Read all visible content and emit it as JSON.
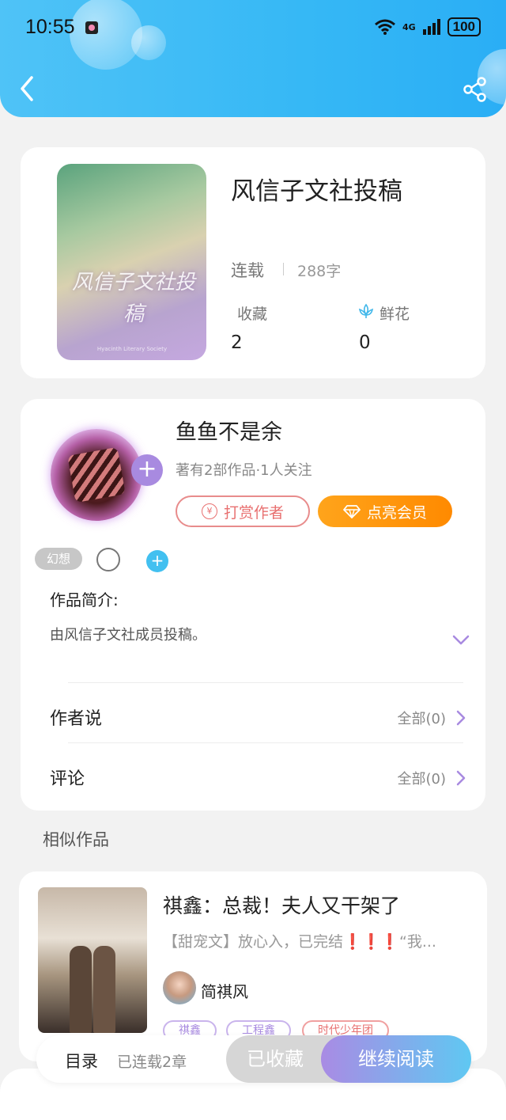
{
  "status_bar": {
    "time": "10:55",
    "network": "4G",
    "battery": "100"
  },
  "book": {
    "title": "风信子文社投稿",
    "status": "连载",
    "word_count": "288字",
    "favorites_label": "收藏",
    "favorites_count": "2",
    "flowers_label": "鲜花",
    "flowers_count": "0",
    "cover_text": "风信子文社投稿",
    "cover_subtext": "Hyacinth Literary Society"
  },
  "author": {
    "name": "鱼鱼不是余",
    "stats": "著有2部作品·1人关注",
    "tip_button": "打赏作者",
    "tip_icon_glyph": "¥",
    "vip_button": "点亮会员",
    "follow_glyph": "+",
    "tag": "幻想",
    "add_tag_glyph": "+"
  },
  "intro": {
    "label": "作品简介:",
    "text": "由风信子文社成员投稿。"
  },
  "author_says": {
    "label": "作者说",
    "value": "全部(0)"
  },
  "comments": {
    "label": "评论",
    "value": "全部(0)"
  },
  "similar": {
    "section_title": "相似作品",
    "items": [
      {
        "title": "祺鑫：总裁！夫人又干架了",
        "description": "【甜宠文】放心入，已完结❗❗❗“我...",
        "author": "简祺风",
        "tags": [
          "祺鑫",
          "工程鑫",
          "时代少年团"
        ]
      }
    ]
  },
  "bottom_bar": {
    "toc_label": "目录",
    "chapter_count": "已连载2章",
    "collected_label": "已收藏",
    "read_label": "继续阅读"
  },
  "colors": {
    "header": "#36b8f5",
    "vip": "#ff8a00",
    "tip": "#e87070",
    "accent_purple": "#a88ae0"
  }
}
